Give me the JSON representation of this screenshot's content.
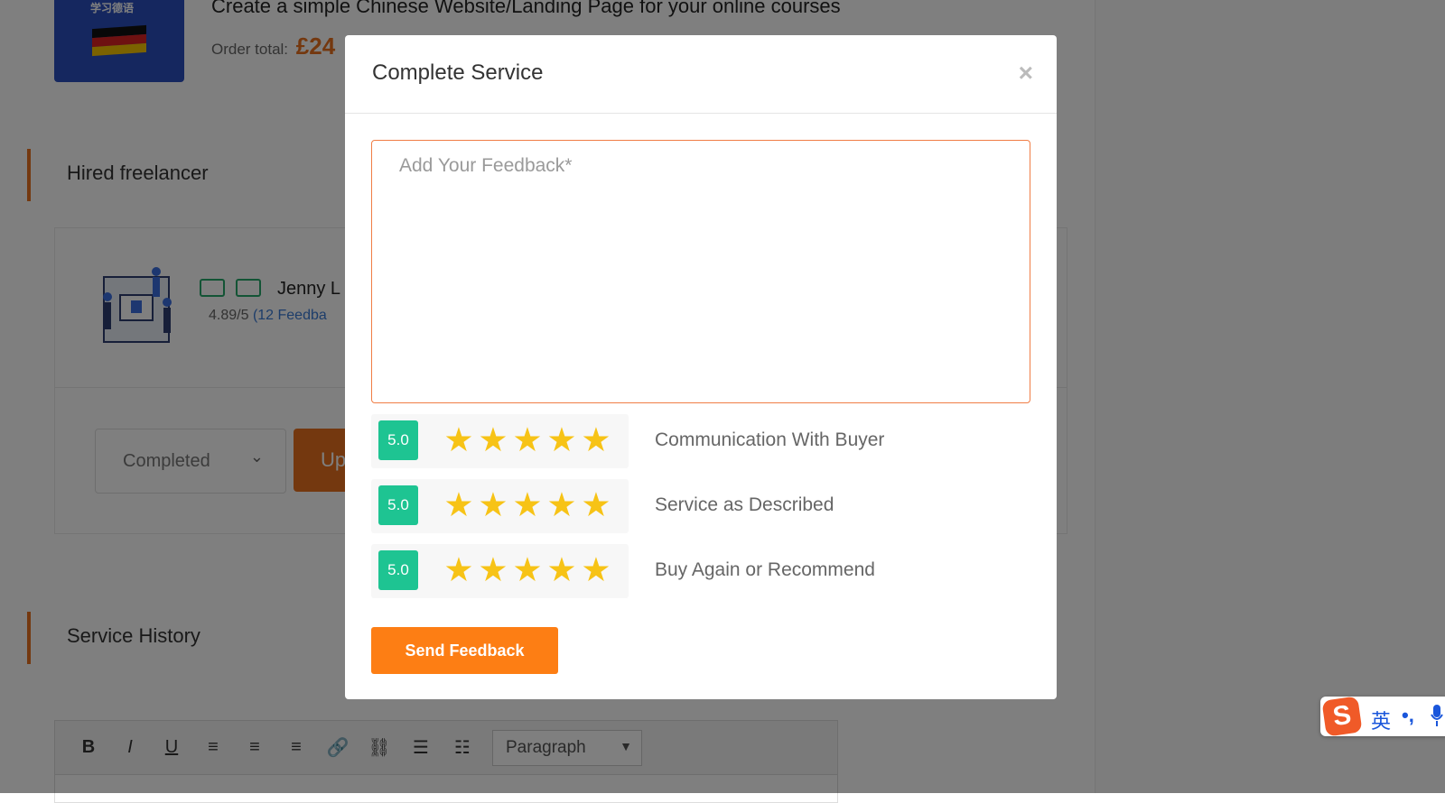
{
  "background": {
    "service": {
      "thumb_text": "学习德语",
      "title": "Create a simple Chinese Website/Landing Page for your online courses",
      "order_total_label": "Order total:",
      "order_total_value": "£24"
    },
    "hired_section_title": "Hired freelancer",
    "freelancer": {
      "name": "Jenny L",
      "rating": "4.89/5",
      "feedback_count": "(12 Feedba"
    },
    "status_select": {
      "value": "Completed"
    },
    "update_button_label": "Up",
    "history_section_title": "Service History",
    "editor": {
      "toolbar": [
        "B",
        "I",
        "U",
        "≡",
        "≡",
        "≡",
        "🔗",
        "⛓",
        "☰",
        "☷"
      ],
      "block_format": "Paragraph"
    }
  },
  "modal": {
    "title": "Complete Service",
    "close_symbol": "×",
    "feedback_placeholder": "Add Your Feedback*",
    "feedback_value": "",
    "ratings": [
      {
        "score": "5.0",
        "stars": 5,
        "label": "Communication With Buyer"
      },
      {
        "score": "5.0",
        "stars": 5,
        "label": "Service as Described"
      },
      {
        "score": "5.0",
        "stars": 5,
        "label": "Buy Again or Recommend"
      }
    ],
    "submit_label": "Send Feedback"
  },
  "ime": {
    "logo": "S",
    "language": "英",
    "punctuation": "•,"
  },
  "colors": {
    "accent": "#fd7e14",
    "score_badge": "#1ec492",
    "star": "#f7c316",
    "overlay": "rgba(0,0,0,0.5)"
  }
}
